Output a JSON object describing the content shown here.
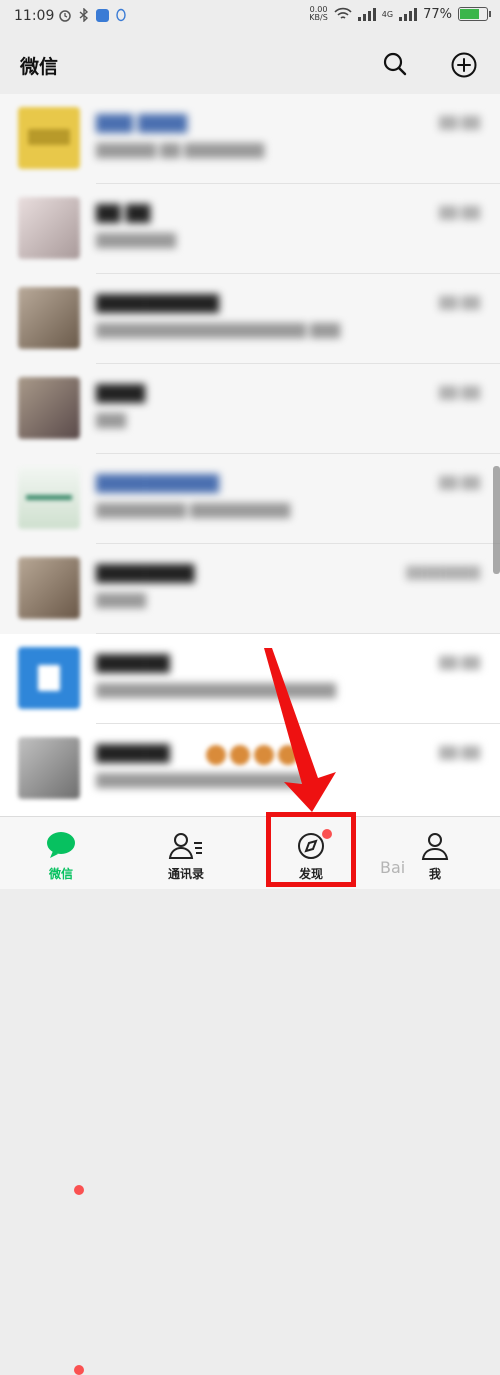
{
  "status_bar": {
    "time": "11:09",
    "net_speed_value": "0.00",
    "net_speed_unit": "KB/S",
    "signal_2_tag": "4G",
    "battery": "77%",
    "battery_level": 0.77
  },
  "header": {
    "title": "微信"
  },
  "chats": [
    {
      "avatar_color": "#e8c84a",
      "name_color": "blue",
      "badge": false
    },
    {
      "avatar_color": "#c9b5b5",
      "badge": true
    },
    {
      "avatar_color": "#9a8a7a",
      "badge": false
    },
    {
      "avatar_color": "#7b6f6a",
      "badge": false
    },
    {
      "avatar_color": "#dfe8df",
      "name_color": "blue",
      "badge": false
    },
    {
      "avatar_color": "#8c7a6a",
      "badge": false
    },
    {
      "avatar_color": "#2f86d9",
      "badge": true
    },
    {
      "avatar_color": "#8a8a8a",
      "badge": true
    }
  ],
  "tabbar": {
    "tabs": [
      {
        "label": "微信",
        "active": true
      },
      {
        "label": "通讯录",
        "active": false
      },
      {
        "label": "发现",
        "active": false,
        "badge": true
      },
      {
        "label": "我",
        "active": false
      }
    ]
  },
  "colors": {
    "accent_green": "#07c160",
    "highlight_red": "#ee1111",
    "badge_red": "#fa5151"
  },
  "watermark": "Bai"
}
